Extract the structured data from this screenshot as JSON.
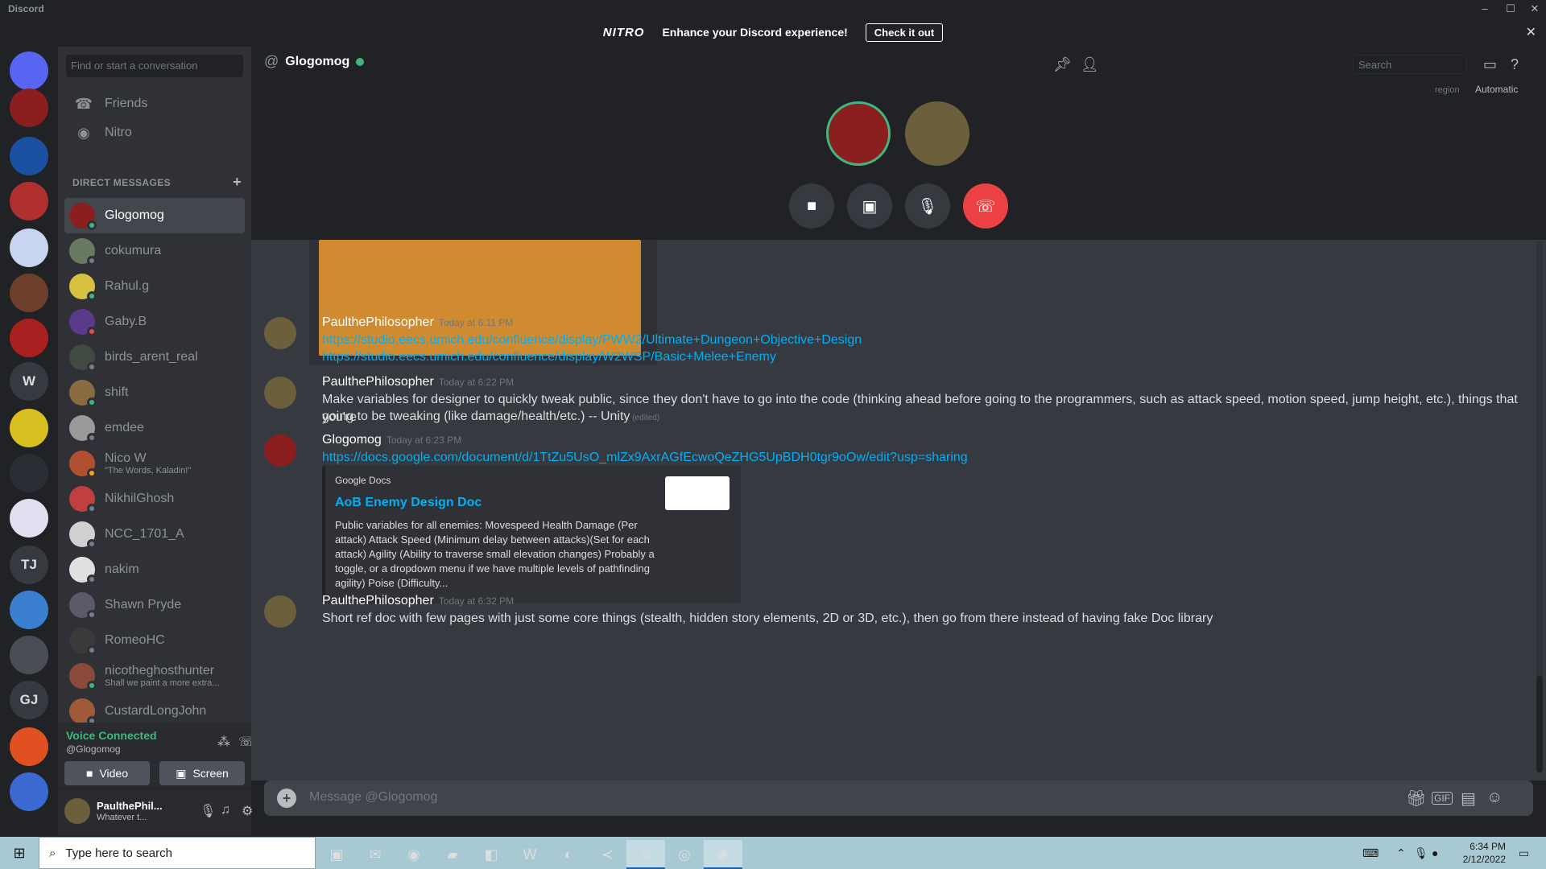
{
  "window": {
    "title": "Discord",
    "minimize": "–",
    "maximize": "☐",
    "close": "✕"
  },
  "nitro_banner": {
    "logo": "NITRO",
    "text": "Enhance your Discord experience!",
    "cta": "Check it out",
    "close": "✕"
  },
  "guilds": [
    {
      "label": "",
      "color": "#5865f2",
      "icon": "discord-home-icon"
    },
    {
      "label": "",
      "color": "#8b1e1e",
      "icon": "server-avatar"
    },
    {
      "label": "",
      "color": "#1b4fa0",
      "icon": "server-avatar"
    },
    {
      "label": "",
      "color": "#b03030",
      "icon": "server-avatar"
    },
    {
      "label": "",
      "color": "#c8d4f0",
      "icon": "server-avatar"
    },
    {
      "label": "",
      "color": "#6b3f2a",
      "icon": "server-avatar"
    },
    {
      "label": "",
      "color": "#a82020",
      "icon": "server-avatar"
    },
    {
      "label": "W",
      "color": "#36393f",
      "icon": ""
    },
    {
      "label": "",
      "color": "#d8c020",
      "icon": "server-avatar"
    },
    {
      "label": "",
      "color": "#2a2d33",
      "icon": "server-avatar"
    },
    {
      "label": "",
      "color": "#e0e0f0",
      "icon": "server-avatar"
    },
    {
      "label": "TJ",
      "color": "#36393f",
      "icon": ""
    },
    {
      "label": "",
      "color": "#3a7fd0",
      "icon": "server-avatar"
    },
    {
      "label": "",
      "color": "#4a4d55",
      "icon": "server-avatar"
    },
    {
      "label": "GJ",
      "color": "#36393f",
      "icon": ""
    },
    {
      "label": "",
      "color": "#e05020",
      "icon": "server-avatar"
    },
    {
      "label": "",
      "color": "#3a6ad0",
      "icon": "server-avatar"
    },
    {
      "label": "",
      "color": "#403530",
      "icon": "server-avatar"
    }
  ],
  "sidebar": {
    "search_placeholder": "Find or start a conversation",
    "friends": "Friends",
    "nitro": "Nitro",
    "dm_header": "DIRECT MESSAGES",
    "dms": [
      {
        "name": "Glogomog",
        "sub": "",
        "avatar": "#8b1e1e",
        "status": "#43b581",
        "active": true
      },
      {
        "name": "cokumura",
        "sub": "",
        "avatar": "#6a7a60",
        "status": "#747f8d"
      },
      {
        "name": "Rahul.g",
        "sub": "",
        "avatar": "#d8c040",
        "status": "#43b581"
      },
      {
        "name": "Gaby.B",
        "sub": "",
        "avatar": "#5a3a8a",
        "status": "#f04747"
      },
      {
        "name": "birds_arent_real",
        "sub": "",
        "avatar": "#404a40",
        "status": "#747f8d"
      },
      {
        "name": "shift",
        "sub": "",
        "avatar": "#8a6a40",
        "status": "#43b581"
      },
      {
        "name": "emdee",
        "sub": "",
        "avatar": "#9a9a9a",
        "status": "#747f8d"
      },
      {
        "name": "Nico W",
        "sub": "\"The Words, Kaladin!\"",
        "avatar": "#b05030",
        "status": "#faa61a"
      },
      {
        "name": "NikhilGhosh",
        "sub": "",
        "avatar": "#c04040",
        "status": "#747f8d"
      },
      {
        "name": "NCC_1701_A",
        "sub": "",
        "avatar": "#d0d0d0",
        "status": "#747f8d"
      },
      {
        "name": "nakim",
        "sub": "",
        "avatar": "#e0e0e0",
        "status": "#747f8d"
      },
      {
        "name": "Shawn Pryde",
        "sub": "",
        "avatar": "#5a5a6a",
        "status": "#747f8d"
      },
      {
        "name": "RomeoHC",
        "sub": "",
        "avatar": "#3a3a3a",
        "status": "#747f8d"
      },
      {
        "name": "nicotheghosthunter",
        "sub": "Shall we paint a more extra...",
        "avatar": "#8a4a3a",
        "status": "#43b581"
      },
      {
        "name": "CustardLongJohn",
        "sub": "",
        "avatar": "#a05a3a",
        "status": "#747f8d"
      }
    ]
  },
  "voice_panel": {
    "status": "Voice Connected",
    "channel": "@Glogomog",
    "video": "Video",
    "screen": "Screen"
  },
  "user_panel": {
    "name": "PaulthePhil...",
    "status": "Whatever t..."
  },
  "channel": {
    "name": "Glogomog",
    "search_placeholder": "Search",
    "region_label": "region",
    "region_value": "Automatic"
  },
  "messages": [
    {
      "author": "PaulthePhilosopher",
      "time": "Today at 6:11 PM",
      "avatar": "#6b5f3c",
      "lines": [
        "https://studio.eecs.umich.edu/confluence/display/PWW2/Ultimate+Dungeon+Objective+Design",
        "https://studio.eecs.umich.edu/confluence/display/W2WSP/Basic+Melee+Enemy"
      ]
    },
    {
      "author": "PaulthePhilosopher",
      "time": "Today at 6:22 PM",
      "avatar": "#6b5f3c",
      "lines": [
        "Make variables for designer to quickly tweak public, since they don't have to go into the code (thinking ahead before going to the programmers, such as attack speed, motion speed, jump height, etc.), things that you're",
        "going to be tweaking (like damage/health/etc.) -- Unity"
      ],
      "edited": "(edited)"
    },
    {
      "author": "Glogomog",
      "time": "Today at 6:23 PM",
      "avatar": "#8b1e1e",
      "lines": [
        "https://docs.google.com/document/d/1TtZu5UsO_mlZx9AxrAGfEcwoQeZHG5UpBDH0tgr9oOw/edit?usp=sharing"
      ],
      "embed": {
        "provider": "Google Docs",
        "title": "AoB Enemy Design Doc",
        "description": "Public variables for all enemies: Movespeed Health Damage (Per attack) Attack Speed (Minimum delay between attacks)(Set for each attack) Agility (Ability to traverse small elevation changes) Probably a toggle, or a dropdown menu if we have multiple levels of pathfinding agility) Poise (Difficulty..."
      }
    },
    {
      "author": "PaulthePhilosopher",
      "time": "Today at 6:32 PM",
      "avatar": "#6b5f3c",
      "lines": [
        "Short ref doc with few pages with just some core things (stealth, hidden story elements, 2D or 3D, etc.), then go from there instead of having fake Doc library"
      ]
    }
  ],
  "composer": {
    "placeholder": "Message @Glogomog",
    "gif": "GIF"
  },
  "taskbar": {
    "search": "Type here to search",
    "time": "6:34 PM",
    "date": "2/12/2022"
  }
}
